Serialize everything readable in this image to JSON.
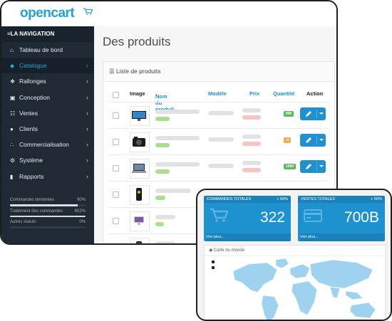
{
  "brand": {
    "logo_text": "opencart",
    "color": "#23a1d1"
  },
  "sidebar": {
    "header": "LA NAVIGATION",
    "items": [
      {
        "label": "Tableau de bord",
        "icon": "home-icon",
        "has_chevron": false
      },
      {
        "label": "Catalogue",
        "icon": "tag-icon",
        "active": true,
        "has_chevron": true
      },
      {
        "label": "Rallonges",
        "icon": "puzzle-icon",
        "has_chevron": true
      },
      {
        "label": "Conception",
        "icon": "monitor-icon",
        "has_chevron": true
      },
      {
        "label": "Ventes",
        "icon": "cart-icon",
        "has_chevron": true
      },
      {
        "label": "Clients",
        "icon": "user-icon",
        "has_chevron": true
      },
      {
        "label": "Commercialisation",
        "icon": "share-icon",
        "has_chevron": true
      },
      {
        "label": "Système",
        "icon": "gear-icon",
        "has_chevron": true
      },
      {
        "label": "Rapports",
        "icon": "chart-icon",
        "has_chevron": true
      }
    ],
    "stats": [
      {
        "label": "Commandes terminées",
        "percent": "90%",
        "fraction": 0.9
      },
      {
        "label": "Traitement des commandes",
        "percent": "602%",
        "fraction": 1.0
      },
      {
        "label": "Autres statuts",
        "percent": "0%",
        "fraction": 0.0
      }
    ]
  },
  "main": {
    "title": "Des produits",
    "panel_title": "Liste de produits",
    "columns": {
      "image": "Image",
      "name": "Nom du produit",
      "model": "Modèle",
      "price": "Prix",
      "quantity": "Quantité",
      "action": "Action"
    },
    "rows": [
      {
        "image": "monitor-thumbnail",
        "quantity": "990",
        "quantity_color": "#5cb85c"
      },
      {
        "image": "camera-thumbnail",
        "quantity": "-4",
        "quantity_color": "#f0ad4e"
      },
      {
        "image": "laptop-thumbnail",
        "quantity": "1000",
        "quantity_color": "#5cb85c"
      },
      {
        "image": "phone-thumbnail",
        "quantity": "",
        "quantity_color": ""
      },
      {
        "image": "imac-thumbnail",
        "quantity": "",
        "quantity_color": ""
      },
      {
        "image": "smartphone-thumbnail",
        "quantity": "",
        "quantity_color": ""
      }
    ],
    "accent": "#1e91cf"
  },
  "dashboard": {
    "tiles": [
      {
        "title": "COMMANDES TOTALES",
        "change": "+ 60%",
        "value": "322",
        "link": "Voir plus...",
        "icon": "cart-icon"
      },
      {
        "title": "VENTES TOTALES",
        "change": "+ 60%",
        "value": "700B",
        "link": "Voir plus...",
        "icon": "credit-card-icon"
      }
    ],
    "map_title": "Carte du monde",
    "map_color": "#9fd2ee"
  }
}
